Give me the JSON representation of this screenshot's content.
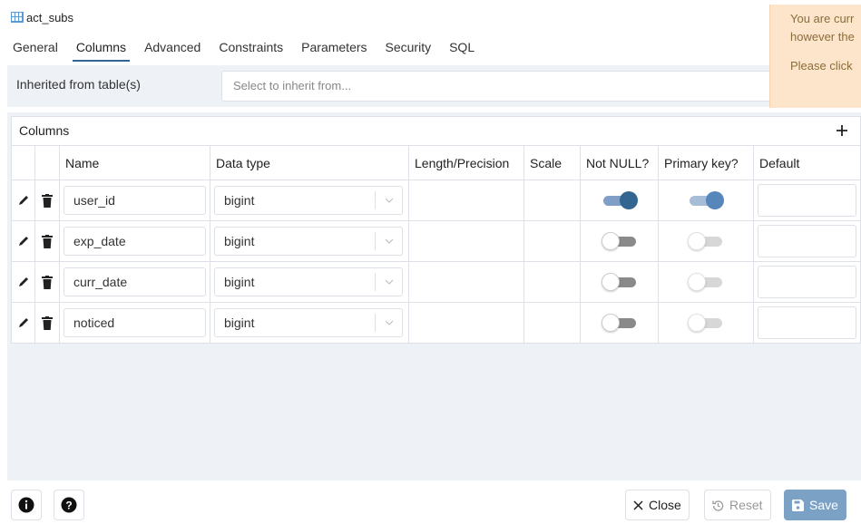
{
  "window": {
    "title": "act_subs",
    "icon": "table-icon"
  },
  "tabs": [
    {
      "label": "General",
      "active": false
    },
    {
      "label": "Columns",
      "active": true
    },
    {
      "label": "Advanced",
      "active": false
    },
    {
      "label": "Constraints",
      "active": false
    },
    {
      "label": "Parameters",
      "active": false
    },
    {
      "label": "Security",
      "active": false
    },
    {
      "label": "SQL",
      "active": false
    }
  ],
  "inherit": {
    "label": "Inherited from table(s)",
    "placeholder": "Select to inherit from..."
  },
  "notice": {
    "line1": "You are curr",
    "line2": "however the",
    "line3": "Please click"
  },
  "columns_grid": {
    "title": "Columns",
    "headers": {
      "name": "Name",
      "data_type": "Data type",
      "length": "Length/Precision",
      "scale": "Scale",
      "not_null": "Not NULL?",
      "primary_key": "Primary key?",
      "default": "Default"
    },
    "rows": [
      {
        "name": "user_id",
        "type": "bigint",
        "not_null": true,
        "primary_key": true
      },
      {
        "name": "exp_date",
        "type": "bigint",
        "not_null": false,
        "primary_key": false
      },
      {
        "name": "curr_date",
        "type": "bigint",
        "not_null": false,
        "primary_key": false
      },
      {
        "name": "noticed",
        "type": "bigint",
        "not_null": false,
        "primary_key": false
      }
    ]
  },
  "footer": {
    "info_icon": "info-icon",
    "help_icon": "help-icon",
    "close_label": "Close",
    "reset_label": "Reset",
    "save_label": "Save"
  },
  "colors": {
    "accent": "#326690",
    "save_button": "#7ba1c5",
    "notice_bg": "#fde5cc",
    "panel_bg": "#eef1f5"
  }
}
